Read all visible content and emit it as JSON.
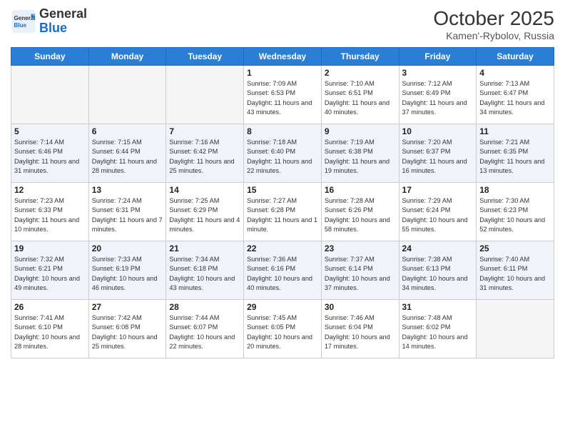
{
  "header": {
    "logo": {
      "general": "General",
      "blue": "Blue"
    },
    "month": "October 2025",
    "location": "Kamen'-Rybolov, Russia"
  },
  "weekdays": [
    "Sunday",
    "Monday",
    "Tuesday",
    "Wednesday",
    "Thursday",
    "Friday",
    "Saturday"
  ],
  "weeks": [
    [
      {
        "day": "",
        "empty": true
      },
      {
        "day": "",
        "empty": true
      },
      {
        "day": "",
        "empty": true
      },
      {
        "day": "1",
        "sunrise": "7:09 AM",
        "sunset": "6:53 PM",
        "daylight": "11 hours and 43 minutes."
      },
      {
        "day": "2",
        "sunrise": "7:10 AM",
        "sunset": "6:51 PM",
        "daylight": "11 hours and 40 minutes."
      },
      {
        "day": "3",
        "sunrise": "7:12 AM",
        "sunset": "6:49 PM",
        "daylight": "11 hours and 37 minutes."
      },
      {
        "day": "4",
        "sunrise": "7:13 AM",
        "sunset": "6:47 PM",
        "daylight": "11 hours and 34 minutes."
      }
    ],
    [
      {
        "day": "5",
        "sunrise": "7:14 AM",
        "sunset": "6:46 PM",
        "daylight": "11 hours and 31 minutes."
      },
      {
        "day": "6",
        "sunrise": "7:15 AM",
        "sunset": "6:44 PM",
        "daylight": "11 hours and 28 minutes."
      },
      {
        "day": "7",
        "sunrise": "7:16 AM",
        "sunset": "6:42 PM",
        "daylight": "11 hours and 25 minutes."
      },
      {
        "day": "8",
        "sunrise": "7:18 AM",
        "sunset": "6:40 PM",
        "daylight": "11 hours and 22 minutes."
      },
      {
        "day": "9",
        "sunrise": "7:19 AM",
        "sunset": "6:38 PM",
        "daylight": "11 hours and 19 minutes."
      },
      {
        "day": "10",
        "sunrise": "7:20 AM",
        "sunset": "6:37 PM",
        "daylight": "11 hours and 16 minutes."
      },
      {
        "day": "11",
        "sunrise": "7:21 AM",
        "sunset": "6:35 PM",
        "daylight": "11 hours and 13 minutes."
      }
    ],
    [
      {
        "day": "12",
        "sunrise": "7:23 AM",
        "sunset": "6:33 PM",
        "daylight": "11 hours and 10 minutes."
      },
      {
        "day": "13",
        "sunrise": "7:24 AM",
        "sunset": "6:31 PM",
        "daylight": "11 hours and 7 minutes."
      },
      {
        "day": "14",
        "sunrise": "7:25 AM",
        "sunset": "6:29 PM",
        "daylight": "11 hours and 4 minutes."
      },
      {
        "day": "15",
        "sunrise": "7:27 AM",
        "sunset": "6:28 PM",
        "daylight": "11 hours and 1 minute."
      },
      {
        "day": "16",
        "sunrise": "7:28 AM",
        "sunset": "6:26 PM",
        "daylight": "10 hours and 58 minutes."
      },
      {
        "day": "17",
        "sunrise": "7:29 AM",
        "sunset": "6:24 PM",
        "daylight": "10 hours and 55 minutes."
      },
      {
        "day": "18",
        "sunrise": "7:30 AM",
        "sunset": "6:23 PM",
        "daylight": "10 hours and 52 minutes."
      }
    ],
    [
      {
        "day": "19",
        "sunrise": "7:32 AM",
        "sunset": "6:21 PM",
        "daylight": "10 hours and 49 minutes."
      },
      {
        "day": "20",
        "sunrise": "7:33 AM",
        "sunset": "6:19 PM",
        "daylight": "10 hours and 46 minutes."
      },
      {
        "day": "21",
        "sunrise": "7:34 AM",
        "sunset": "6:18 PM",
        "daylight": "10 hours and 43 minutes."
      },
      {
        "day": "22",
        "sunrise": "7:36 AM",
        "sunset": "6:16 PM",
        "daylight": "10 hours and 40 minutes."
      },
      {
        "day": "23",
        "sunrise": "7:37 AM",
        "sunset": "6:14 PM",
        "daylight": "10 hours and 37 minutes."
      },
      {
        "day": "24",
        "sunrise": "7:38 AM",
        "sunset": "6:13 PM",
        "daylight": "10 hours and 34 minutes."
      },
      {
        "day": "25",
        "sunrise": "7:40 AM",
        "sunset": "6:11 PM",
        "daylight": "10 hours and 31 minutes."
      }
    ],
    [
      {
        "day": "26",
        "sunrise": "7:41 AM",
        "sunset": "6:10 PM",
        "daylight": "10 hours and 28 minutes."
      },
      {
        "day": "27",
        "sunrise": "7:42 AM",
        "sunset": "6:08 PM",
        "daylight": "10 hours and 25 minutes."
      },
      {
        "day": "28",
        "sunrise": "7:44 AM",
        "sunset": "6:07 PM",
        "daylight": "10 hours and 22 minutes."
      },
      {
        "day": "29",
        "sunrise": "7:45 AM",
        "sunset": "6:05 PM",
        "daylight": "10 hours and 20 minutes."
      },
      {
        "day": "30",
        "sunrise": "7:46 AM",
        "sunset": "6:04 PM",
        "daylight": "10 hours and 17 minutes."
      },
      {
        "day": "31",
        "sunrise": "7:48 AM",
        "sunset": "6:02 PM",
        "daylight": "10 hours and 14 minutes."
      },
      {
        "day": "",
        "empty": true
      }
    ]
  ]
}
